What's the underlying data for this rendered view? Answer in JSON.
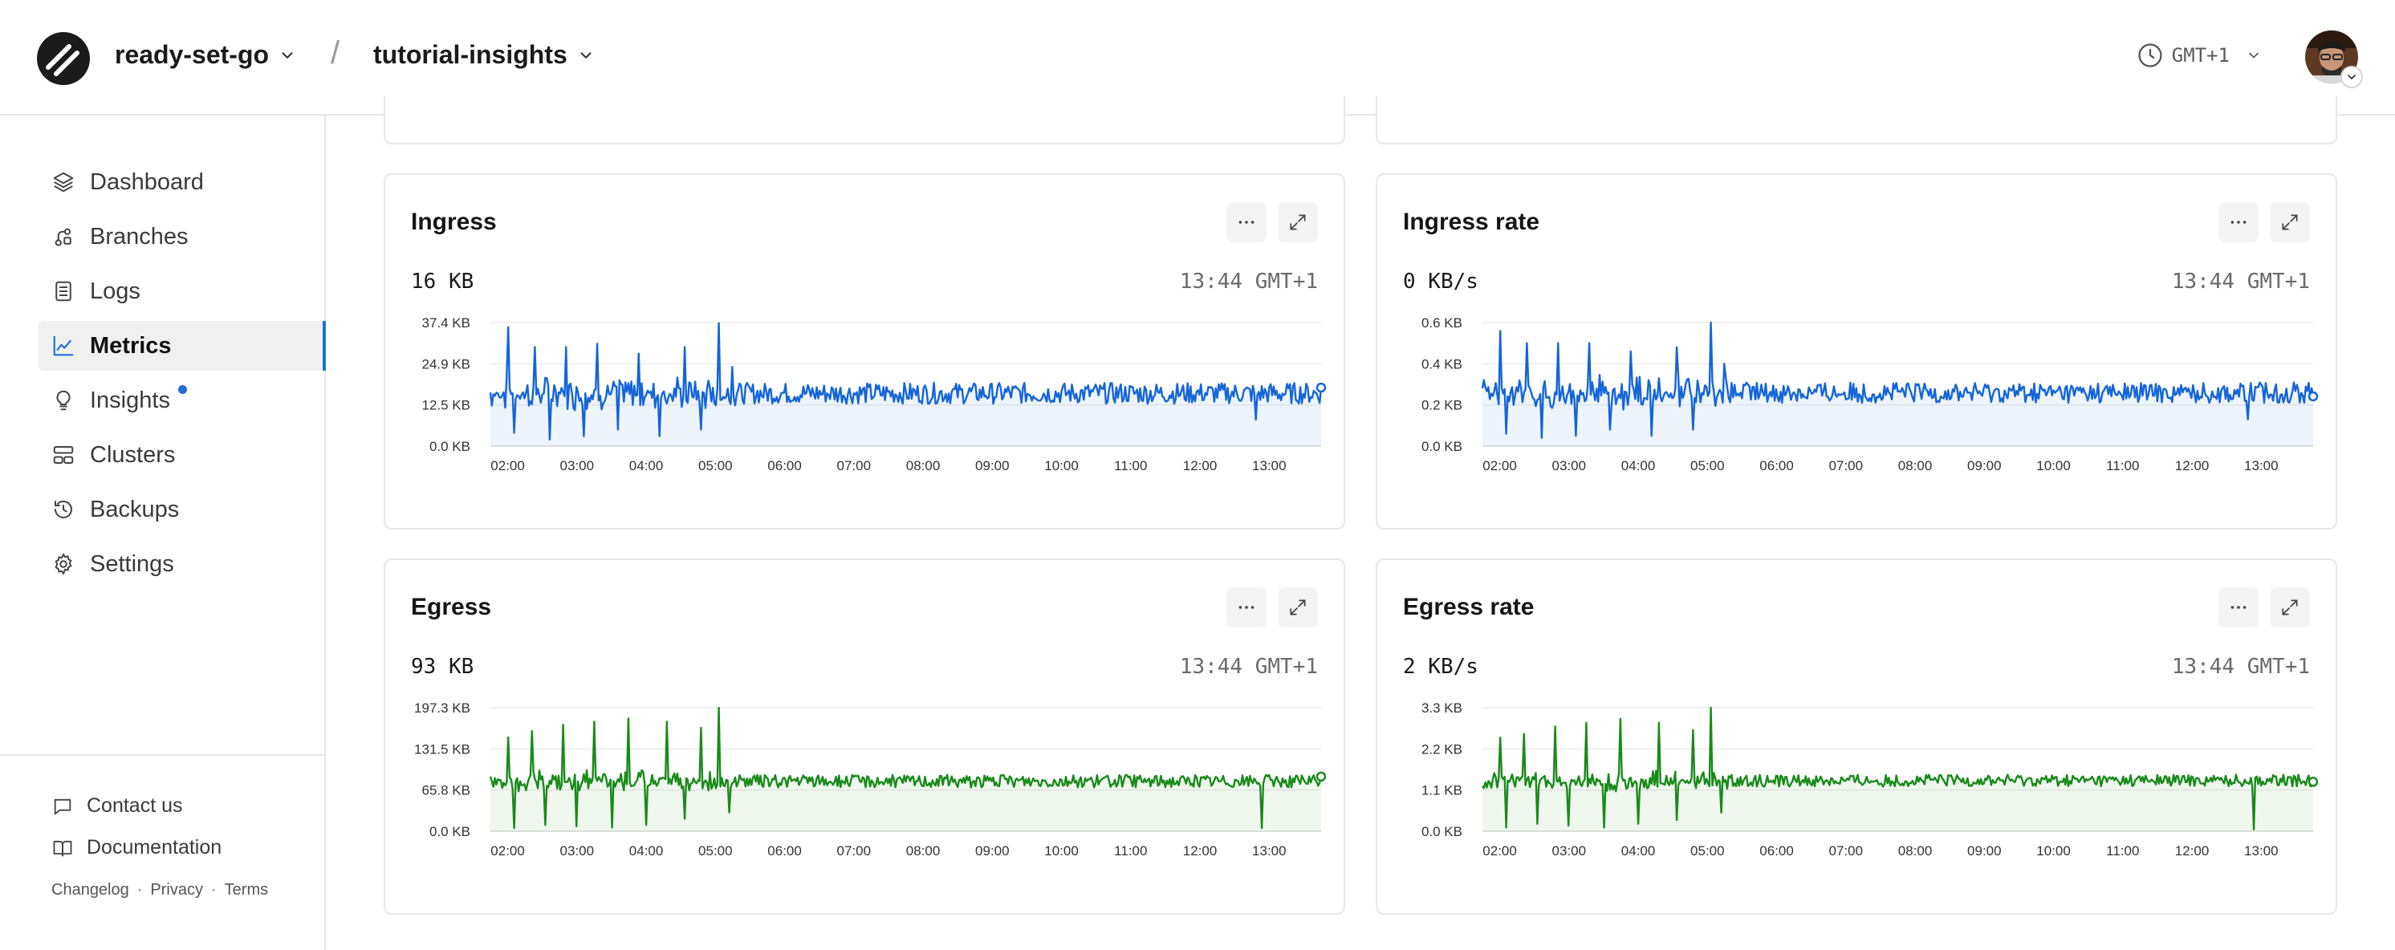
{
  "header": {
    "org": "ready-set-go",
    "separator": "/",
    "project": "tutorial-insights",
    "timezone": "GMT+1"
  },
  "sidebar": {
    "items": [
      {
        "label": "Dashboard",
        "icon": "layers-icon"
      },
      {
        "label": "Branches",
        "icon": "branch-icon"
      },
      {
        "label": "Logs",
        "icon": "document-icon"
      },
      {
        "label": "Metrics",
        "icon": "line-chart-icon",
        "active": true
      },
      {
        "label": "Insights",
        "icon": "lightbulb-icon",
        "notification": true
      },
      {
        "label": "Clusters",
        "icon": "clusters-icon"
      },
      {
        "label": "Backups",
        "icon": "history-icon"
      },
      {
        "label": "Settings",
        "icon": "gear-icon"
      }
    ],
    "footer": {
      "contact": "Contact us",
      "docs": "Documentation",
      "changelog": "Changelog",
      "privacy": "Privacy",
      "terms": "Terms",
      "dot": "·"
    }
  },
  "colors": {
    "accent": "#1f6fd6",
    "ingress": "#1565d8",
    "egress": "#1a8a1a"
  },
  "cards": [
    {
      "id": "ingress",
      "title": "Ingress",
      "stat": "16 KB",
      "time": "13:44 GMT+1"
    },
    {
      "id": "ingress-rate",
      "title": "Ingress rate",
      "stat": "0 KB/s",
      "time": "13:44 GMT+1"
    },
    {
      "id": "egress",
      "title": "Egress",
      "stat": "93 KB",
      "time": "13:44 GMT+1"
    },
    {
      "id": "egress-rate",
      "title": "Egress rate",
      "stat": "2 KB/s",
      "time": "13:44 GMT+1"
    }
  ],
  "chart_data": [
    {
      "type": "area",
      "title": "Ingress",
      "color": "#1565d8",
      "x_ticks": [
        "02:00",
        "03:00",
        "04:00",
        "05:00",
        "06:00",
        "07:00",
        "08:00",
        "09:00",
        "10:00",
        "11:00",
        "12:00",
        "13:00"
      ],
      "y_ticks": [
        "0.0 KB",
        "12.5 KB",
        "24.9 KB",
        "37.4 KB"
      ],
      "ylim": [
        0,
        37.4
      ],
      "xlim": [
        "01:45",
        "13:45"
      ],
      "baseline": 16,
      "noise": 3.2,
      "grid": true,
      "spikes": [
        [
          2.0,
          36
        ],
        [
          2.1,
          4
        ],
        [
          2.4,
          30
        ],
        [
          2.6,
          2
        ],
        [
          2.85,
          30
        ],
        [
          3.1,
          3
        ],
        [
          3.3,
          31
        ],
        [
          3.6,
          5
        ],
        [
          3.9,
          28
        ],
        [
          4.2,
          3
        ],
        [
          4.55,
          30
        ],
        [
          4.8,
          5
        ],
        [
          5.05,
          37.2
        ],
        [
          5.25,
          24
        ],
        [
          12.8,
          8
        ]
      ]
    },
    {
      "type": "area",
      "title": "Ingress rate",
      "color": "#1565d8",
      "x_ticks": [
        "02:00",
        "03:00",
        "04:00",
        "05:00",
        "06:00",
        "07:00",
        "08:00",
        "09:00",
        "10:00",
        "11:00",
        "12:00",
        "13:00"
      ],
      "y_ticks": [
        "0.0 KB",
        "0.2 KB",
        "0.4 KB",
        "0.6 KB"
      ],
      "ylim": [
        0,
        0.6
      ],
      "xlim": [
        "01:45",
        "13:45"
      ],
      "baseline": 0.26,
      "noise": 0.05,
      "grid": true,
      "spikes": [
        [
          2.0,
          0.56
        ],
        [
          2.1,
          0.06
        ],
        [
          2.4,
          0.5
        ],
        [
          2.6,
          0.04
        ],
        [
          2.85,
          0.5
        ],
        [
          3.1,
          0.05
        ],
        [
          3.3,
          0.5
        ],
        [
          3.6,
          0.08
        ],
        [
          3.9,
          0.46
        ],
        [
          4.2,
          0.05
        ],
        [
          4.55,
          0.48
        ],
        [
          4.8,
          0.08
        ],
        [
          5.05,
          0.6
        ],
        [
          5.25,
          0.4
        ],
        [
          12.8,
          0.13
        ]
      ]
    },
    {
      "type": "area",
      "title": "Egress",
      "color": "#1a8a1a",
      "x_ticks": [
        "02:00",
        "03:00",
        "04:00",
        "05:00",
        "06:00",
        "07:00",
        "08:00",
        "09:00",
        "10:00",
        "11:00",
        "12:00",
        "13:00"
      ],
      "y_ticks": [
        "0.0 KB",
        "65.8 KB",
        "131.5 KB",
        "197.3 KB"
      ],
      "ylim": [
        0,
        197.3
      ],
      "xlim": [
        "01:45",
        "13:45"
      ],
      "baseline": 80,
      "noise": 10,
      "grid": true,
      "spikes": [
        [
          2.0,
          150
        ],
        [
          2.1,
          5
        ],
        [
          2.35,
          160
        ],
        [
          2.55,
          10
        ],
        [
          2.8,
          170
        ],
        [
          3.0,
          8
        ],
        [
          3.25,
          175
        ],
        [
          3.5,
          6
        ],
        [
          3.75,
          180
        ],
        [
          4.0,
          10
        ],
        [
          4.3,
          175
        ],
        [
          4.55,
          20
        ],
        [
          4.8,
          165
        ],
        [
          5.05,
          197
        ],
        [
          5.2,
          30
        ],
        [
          12.9,
          5
        ]
      ]
    },
    {
      "type": "area",
      "title": "Egress rate",
      "color": "#1a8a1a",
      "x_ticks": [
        "02:00",
        "03:00",
        "04:00",
        "05:00",
        "06:00",
        "07:00",
        "08:00",
        "09:00",
        "10:00",
        "11:00",
        "12:00",
        "13:00"
      ],
      "y_ticks": [
        "0.0 KB",
        "1.1 KB",
        "2.2 KB",
        "3.3 KB"
      ],
      "ylim": [
        0,
        3.3
      ],
      "xlim": [
        "01:45",
        "13:45"
      ],
      "baseline": 1.35,
      "noise": 0.16,
      "grid": true,
      "spikes": [
        [
          2.0,
          2.5
        ],
        [
          2.1,
          0.1
        ],
        [
          2.35,
          2.6
        ],
        [
          2.55,
          0.2
        ],
        [
          2.8,
          2.8
        ],
        [
          3.0,
          0.15
        ],
        [
          3.25,
          2.9
        ],
        [
          3.5,
          0.1
        ],
        [
          3.75,
          3.0
        ],
        [
          4.0,
          0.2
        ],
        [
          4.3,
          2.9
        ],
        [
          4.55,
          0.3
        ],
        [
          4.8,
          2.7
        ],
        [
          5.05,
          3.3
        ],
        [
          5.2,
          0.5
        ],
        [
          12.9,
          0.05
        ]
      ]
    }
  ]
}
